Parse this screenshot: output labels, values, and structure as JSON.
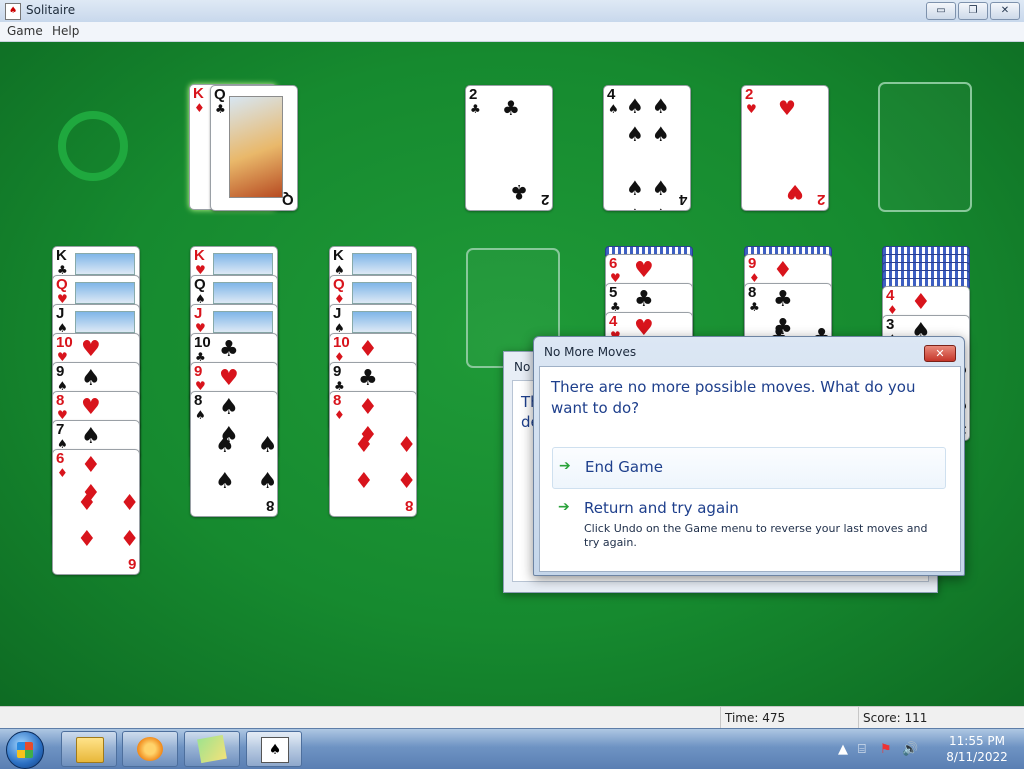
{
  "window": {
    "title": "Solitaire",
    "min": "▭",
    "max": "❐",
    "close": "✕"
  },
  "menu": {
    "items": [
      "Game",
      "Help"
    ]
  },
  "stock": {
    "empty_marker": "redeal-circle"
  },
  "waste": {
    "cards": [
      {
        "rank": "K",
        "suit": "♦",
        "color": "red"
      },
      {
        "rank": "Q",
        "suit": "♣",
        "color": "black"
      }
    ]
  },
  "foundations": [
    {
      "rank": "2",
      "suit": "♣",
      "color": "black",
      "pips": "♣ ♣"
    },
    {
      "rank": "4",
      "suit": "♠",
      "color": "black",
      "pips": "♠♠ ♠♠"
    },
    {
      "rank": "2",
      "suit": "♥",
      "color": "red",
      "pips": "♥ ♥"
    },
    {
      "rank": "",
      "suit": "",
      "color": "",
      "pips": ""
    }
  ],
  "tableau": [
    {
      "cards": [
        {
          "r": "K",
          "s": "♣",
          "c": "black"
        },
        {
          "r": "Q",
          "s": "♥",
          "c": "red"
        },
        {
          "r": "J",
          "s": "♠",
          "c": "black"
        },
        {
          "r": "10",
          "s": "♥",
          "c": "red"
        },
        {
          "r": "9",
          "s": "♠",
          "c": "black"
        },
        {
          "r": "8",
          "s": "♥",
          "c": "red"
        },
        {
          "r": "7",
          "s": "♠",
          "c": "black"
        },
        {
          "r": "6",
          "s": "♦",
          "c": "red"
        }
      ]
    },
    {
      "cards": [
        {
          "r": "K",
          "s": "♥",
          "c": "red"
        },
        {
          "r": "Q",
          "s": "♠",
          "c": "black"
        },
        {
          "r": "J",
          "s": "♥",
          "c": "red"
        },
        {
          "r": "10",
          "s": "♣",
          "c": "black"
        },
        {
          "r": "9",
          "s": "♥",
          "c": "red"
        },
        {
          "r": "8",
          "s": "♠",
          "c": "black"
        }
      ]
    },
    {
      "cards": [
        {
          "r": "K",
          "s": "♠",
          "c": "black"
        },
        {
          "r": "Q",
          "s": "♦",
          "c": "red"
        },
        {
          "r": "J",
          "s": "♠",
          "c": "black"
        },
        {
          "r": "10",
          "s": "♦",
          "c": "red"
        },
        {
          "r": "9",
          "s": "♣",
          "c": "black"
        },
        {
          "r": "8",
          "s": "♦",
          "c": "red"
        }
      ]
    },
    {
      "cards": []
    },
    {
      "cards": [
        {
          "r": "6",
          "s": "♥",
          "c": "red"
        },
        {
          "r": "5",
          "s": "♣",
          "c": "black"
        },
        {
          "r": "4",
          "s": "♥",
          "c": "red"
        }
      ]
    },
    {
      "cards": [
        {
          "r": "9",
          "s": "♦",
          "c": "red"
        },
        {
          "r": "8",
          "s": "♣",
          "c": "black"
        }
      ]
    },
    {
      "cards": [
        {
          "r": "4",
          "s": "♦",
          "c": "red"
        },
        {
          "r": "3",
          "s": "♠",
          "c": "black"
        }
      ]
    }
  ],
  "dialog_back": {
    "title": "No",
    "line1": "Th",
    "line2": "de"
  },
  "dialog": {
    "title": "No More Moves",
    "close": "✕",
    "message": "There are no more possible moves. What do you want to do?",
    "option1": {
      "label": "End Game",
      "arrow": "➔"
    },
    "option2": {
      "label": "Return and try again",
      "arrow": "➔",
      "desc": "Click Undo on the Game menu to reverse your last moves and try again."
    }
  },
  "status": {
    "time": "Time:  475",
    "score": "Score: 111"
  },
  "taskbar": {
    "clock_time": "11:55 PM",
    "clock_date": "8/11/2022",
    "tray_icons": [
      "▲",
      "⌸",
      "⚑",
      "🔊"
    ]
  },
  "colors": {
    "felt": "#1a7a2c",
    "red": "#d8141c",
    "black": "#111111",
    "dialog_text": "#1e3f8c"
  }
}
